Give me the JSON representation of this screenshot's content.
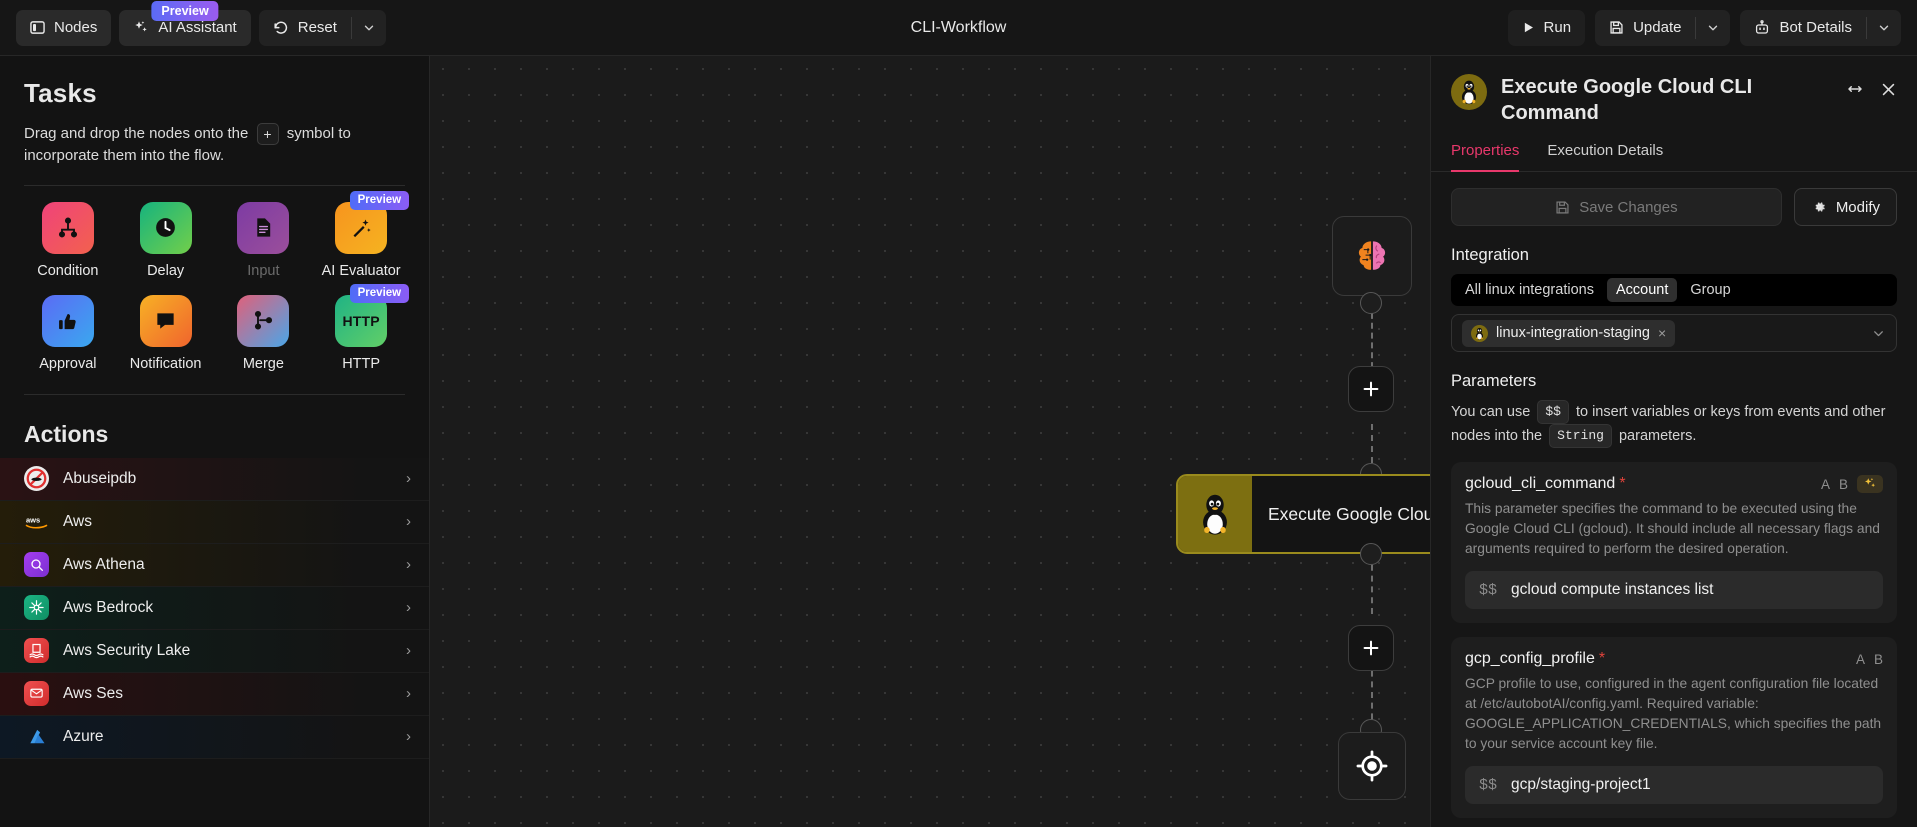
{
  "topbar": {
    "nodes_label": "Nodes",
    "ai_assistant_label": "AI Assistant",
    "ai_assistant_badge": "Preview",
    "reset_label": "Reset",
    "workflow_title": "CLI-Workflow",
    "run_label": "Run",
    "update_label": "Update",
    "bot_details_label": "Bot Details"
  },
  "sidebar": {
    "tasks_title": "Tasks",
    "tasks_hint_before": "Drag and drop the nodes onto the",
    "tasks_hint_plus": "+",
    "tasks_hint_after": "symbol to incorporate them into the flow.",
    "nodes": [
      {
        "label": "Condition",
        "icon": "condition-icon",
        "badge": "",
        "color_a": "#f0437a",
        "color_b": "#f2614e",
        "muted": false
      },
      {
        "label": "Delay",
        "icon": "clock-icon",
        "badge": "",
        "color_a": "#16b37e",
        "color_b": "#72cf4a",
        "muted": false
      },
      {
        "label": "Input",
        "icon": "document-icon",
        "badge": "",
        "color_a": "#7d3ba3",
        "color_b": "#9b4f9b",
        "muted": true
      },
      {
        "label": "AI Evaluator",
        "icon": "magic-wand-icon",
        "badge": "Preview",
        "color_a": "#f7941e",
        "color_b": "#f5b321",
        "muted": false
      },
      {
        "label": "Approval",
        "icon": "thumbs-up-icon",
        "badge": "",
        "color_a": "#5b6bf5",
        "color_b": "#3aa8ef",
        "muted": false
      },
      {
        "label": "Notification",
        "icon": "chat-bubble-icon",
        "badge": "",
        "color_a": "#f7b125",
        "color_b": "#f0642d",
        "muted": false
      },
      {
        "label": "Merge",
        "icon": "merge-icon",
        "badge": "",
        "color_a": "#e0607a",
        "color_b": "#4aa6e8",
        "muted": false
      },
      {
        "label": "HTTP",
        "icon": "http-icon",
        "badge": "Preview",
        "color_a": "#1fb385",
        "color_b": "#62cf67",
        "muted": false
      }
    ],
    "actions_title": "Actions",
    "actions": [
      {
        "label": "Abuseipdb",
        "icon": "abuseipdb-icon",
        "tint": "#2a1214",
        "icon_bg": "#e8e8e8"
      },
      {
        "label": "Aws",
        "icon": "aws-icon",
        "tint": "#241d09",
        "icon_bg": "transparent"
      },
      {
        "label": "Aws Athena",
        "icon": "aws-athena-icon",
        "tint": "#241d09",
        "icon_bg": "#8a33d8"
      },
      {
        "label": "Aws Bedrock",
        "icon": "aws-bedrock-icon",
        "tint": "#0d1f1a",
        "icon_bg": "#18a06e"
      },
      {
        "label": "Aws Security Lake",
        "icon": "aws-security-lake-icon",
        "tint": "#0d1f1a",
        "icon_bg": "#e33c3c"
      },
      {
        "label": "Aws Ses",
        "icon": "aws-ses-icon",
        "tint": "#2a0f10",
        "icon_bg": "#e33c3c"
      },
      {
        "label": "Azure",
        "icon": "azure-icon",
        "tint": "#0d1824",
        "icon_bg": "transparent"
      }
    ],
    "chevron": "›"
  },
  "canvas": {
    "trigger_node_icon": "brain-icon",
    "add_node_label": "+",
    "main_node_title": "Execute Google Cloud …",
    "main_node_icon": "linux-penguin-icon",
    "end_node_icon": "crosshair-icon"
  },
  "panel": {
    "title": "Execute Google Cloud CLI Command",
    "avatar_icon": "linux-penguin-icon",
    "tabs": [
      {
        "label": "Properties",
        "active": true
      },
      {
        "label": "Execution Details",
        "active": false
      }
    ],
    "save_label": "Save Changes",
    "modify_label": "Modify",
    "integration_title": "Integration",
    "integration_segments": [
      {
        "label": "All linux integrations",
        "active": false
      },
      {
        "label": "Account",
        "active": true
      },
      {
        "label": "Group",
        "active": false
      }
    ],
    "integration_chip": "linux-integration-staging",
    "integration_chip_remove": "×",
    "parameters_title": "Parameters",
    "parameters_note_1": "You can use",
    "parameters_note_code_1": "$$",
    "parameters_note_2": "to insert variables or keys from events and other nodes into the",
    "parameters_note_code_2": "String",
    "parameters_note_3": "parameters.",
    "parameters": [
      {
        "name": "gcloud_cli_command",
        "required": "*",
        "tool_a": "A",
        "tool_b": "B",
        "has_ai": true,
        "description": "This parameter specifies the command to be executed using the Google Cloud CLI (gcloud). It should include all necessary flags and arguments required to perform the desired operation.",
        "prefix": "$$",
        "value": "gcloud compute instances list"
      },
      {
        "name": "gcp_config_profile",
        "required": "*",
        "tool_a": "A",
        "tool_b": "B",
        "has_ai": false,
        "description": "GCP profile to use, configured in the agent configuration file located at /etc/autobotAI/config.yaml. Required variable: GOOGLE_APPLICATION_CREDENTIALS, which specifies the path to your service account key file.",
        "prefix": "$$",
        "value": "gcp/staging-project1"
      }
    ]
  },
  "colors": {
    "accent_pink": "#e8386b",
    "node_border": "#9a8b1d",
    "preview_badge_a": "#5b6bf5",
    "preview_badge_b": "#9b5cf0"
  }
}
